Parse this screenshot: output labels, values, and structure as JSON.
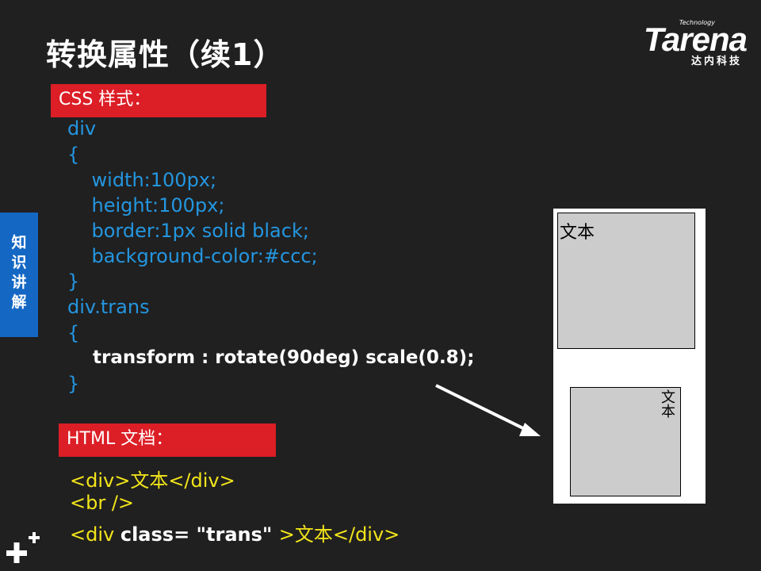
{
  "slide": {
    "title": "转换属性（续1）",
    "brand": {
      "tech": "Technology",
      "name": "Tarena",
      "sub": "达内科技"
    },
    "side_tab": "知识讲解",
    "css_label": "CSS 样式：",
    "css_code": [
      "div",
      "{",
      "    width:100px;",
      "    height:100px;",
      "    border:1px solid black;",
      "    background-color:#ccc;",
      "}",
      "div.trans",
      "{",
      "    transform : rotate(90deg) scale(0.8);",
      "}"
    ],
    "html_label": "HTML 文档：",
    "html_code": {
      "line1": "<div>文本</div>",
      "line2": "<br />",
      "line3_a": "<div ",
      "line3_b": "class=",
      "line3_c": " \"trans\" ",
      "line3_d": ">文本</div>"
    },
    "demo": {
      "box1_text": "文本",
      "box2_text": "文本"
    }
  },
  "colors": {
    "background": "#202020",
    "code_blue": "#2496e0",
    "label_red": "#dc1e26",
    "html_yellow": "#f2e41a",
    "side_blue": "#1468c4"
  }
}
